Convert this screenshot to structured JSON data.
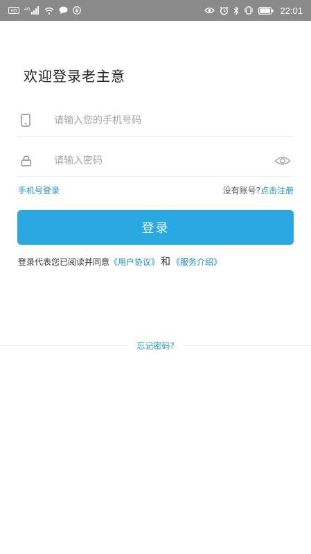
{
  "status_bar": {
    "time": "22:01",
    "icons_left": [
      "hd-icon",
      "signal-4g-icon",
      "wifi-icon",
      "message-icon",
      "download-icon"
    ],
    "icons_right": [
      "eye-icon",
      "alarm-icon",
      "bluetooth-icon",
      "vibrate-icon",
      "battery-icon"
    ]
  },
  "title": "欢迎登录老主意",
  "phone_field": {
    "placeholder": "请输入您的手机号码",
    "value": ""
  },
  "password_field": {
    "placeholder": "请输入密码",
    "value": ""
  },
  "links": {
    "phone_login": "手机号登录",
    "no_account": "没有账号?",
    "register": "点击注册"
  },
  "login_button": "登录",
  "agreement": {
    "prefix": "登录代表您已阅读并同意",
    "user_agreement": "《用户协议》",
    "and": "和",
    "service_intro": "《服务介绍》"
  },
  "forgot_password": "忘记密码?",
  "colors": {
    "accent": "#2aa8e2",
    "link": "#1e8fc9",
    "status_bar": "#8a8a8a"
  }
}
